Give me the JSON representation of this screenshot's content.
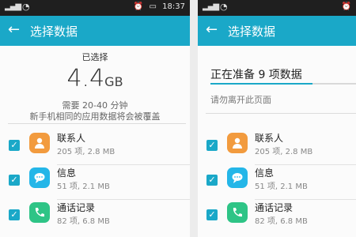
{
  "left": {
    "status": {
      "time": "18:37",
      "signal": "4G"
    },
    "appbar": {
      "title": "选择数据"
    },
    "summary": {
      "selected_label": "已选择",
      "size_value": "4.4",
      "size_unit": "GB",
      "time_needed": "需要 20-40 分钟",
      "overwrite_warning": "新手机相同的应用数据将会被覆盖"
    },
    "items": [
      {
        "name": "联系人",
        "meta": "205 项, 2.8 MB",
        "icon": "contacts-icon"
      },
      {
        "name": "信息",
        "meta": "51 项, 2.1 MB",
        "icon": "messages-icon"
      },
      {
        "name": "通话记录",
        "meta": "82 项, 6.8 MB",
        "icon": "call-log-icon"
      }
    ]
  },
  "right": {
    "status": {
      "signal": "4G"
    },
    "appbar": {
      "title": "选择数据"
    },
    "progress": {
      "title": "正在准备 9 项数据",
      "notice": "请勿离开此页面",
      "fraction": 0.7
    },
    "items": [
      {
        "name": "联系人",
        "meta": "205 项, 2.8 MB",
        "icon": "contacts-icon"
      },
      {
        "name": "信息",
        "meta": "51 项, 2.1 MB",
        "icon": "messages-icon"
      },
      {
        "name": "通话记录",
        "meta": "82 项, 6.8 MB",
        "icon": "call-log-icon"
      }
    ]
  },
  "colors": {
    "accent": "#1aa8c8",
    "contacts": "#f29b3e",
    "messages": "#24b6e8",
    "calls": "#2ec486"
  }
}
